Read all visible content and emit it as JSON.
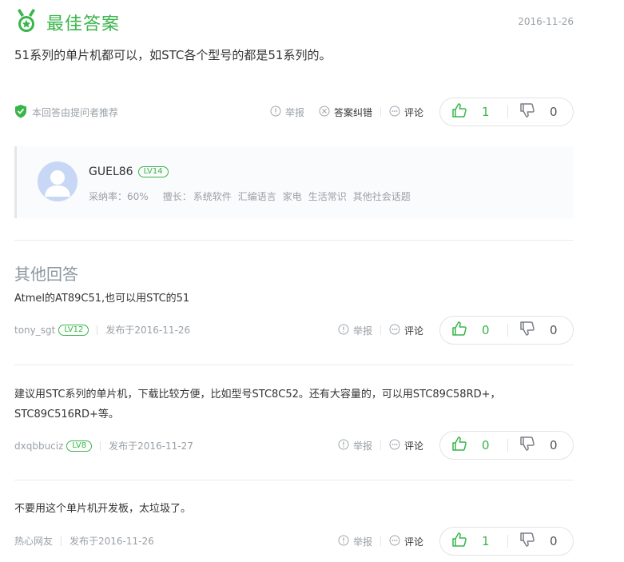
{
  "best": {
    "title": "最佳答案",
    "date": "2016-11-26",
    "content": "51系列的单片机都可以，如STC各个型号的都是51系列的。",
    "recommend": "本回答由提问者推荐",
    "report": "举报",
    "correct": "答案纠错",
    "comment": "评论",
    "likes": "1",
    "dislikes": "0"
  },
  "user": {
    "name": "GUEL86",
    "level": "LV14",
    "adopt_rate": "采纳率：60%",
    "specialty_label": "擅长：",
    "specialties": [
      "系统软件",
      "汇编语言",
      "家电",
      "生活常识",
      "其他社会话题"
    ]
  },
  "other": {
    "title": "其他回答",
    "answers": [
      {
        "content": "Atmel的AT89C51,也可以用STC的51",
        "author": "tony_sgt",
        "level": "LV12",
        "date": "发布于2016-11-26",
        "report": "举报",
        "comment": "评论",
        "likes": "0",
        "dislikes": "0"
      },
      {
        "content": "建议用STC系列的单片机，下载比较方便，比如型号STC8C52。还有大容量的，可以用STC89C58RD+，STC89C516RD+等。",
        "author": "dxqbbuciz",
        "level": "LV8",
        "date": "发布于2016-11-27",
        "report": "举报",
        "comment": "评论",
        "likes": "0",
        "dislikes": "0"
      },
      {
        "content": "不要用这个单片机开发板，太垃圾了。",
        "author": "热心网友",
        "level": "",
        "date": "发布于2016-11-26",
        "report": "举报",
        "comment": "评论",
        "likes": "1",
        "dislikes": "0"
      }
    ]
  },
  "colors": {
    "accent": "#39b54a",
    "muted": "#9aa0a6",
    "text": "#333333"
  },
  "icons": [
    "medal-icon",
    "shield-check-icon",
    "report-icon",
    "correct-icon",
    "comment-icon",
    "thumb-up-icon",
    "thumb-down-icon",
    "avatar-placeholder"
  ]
}
